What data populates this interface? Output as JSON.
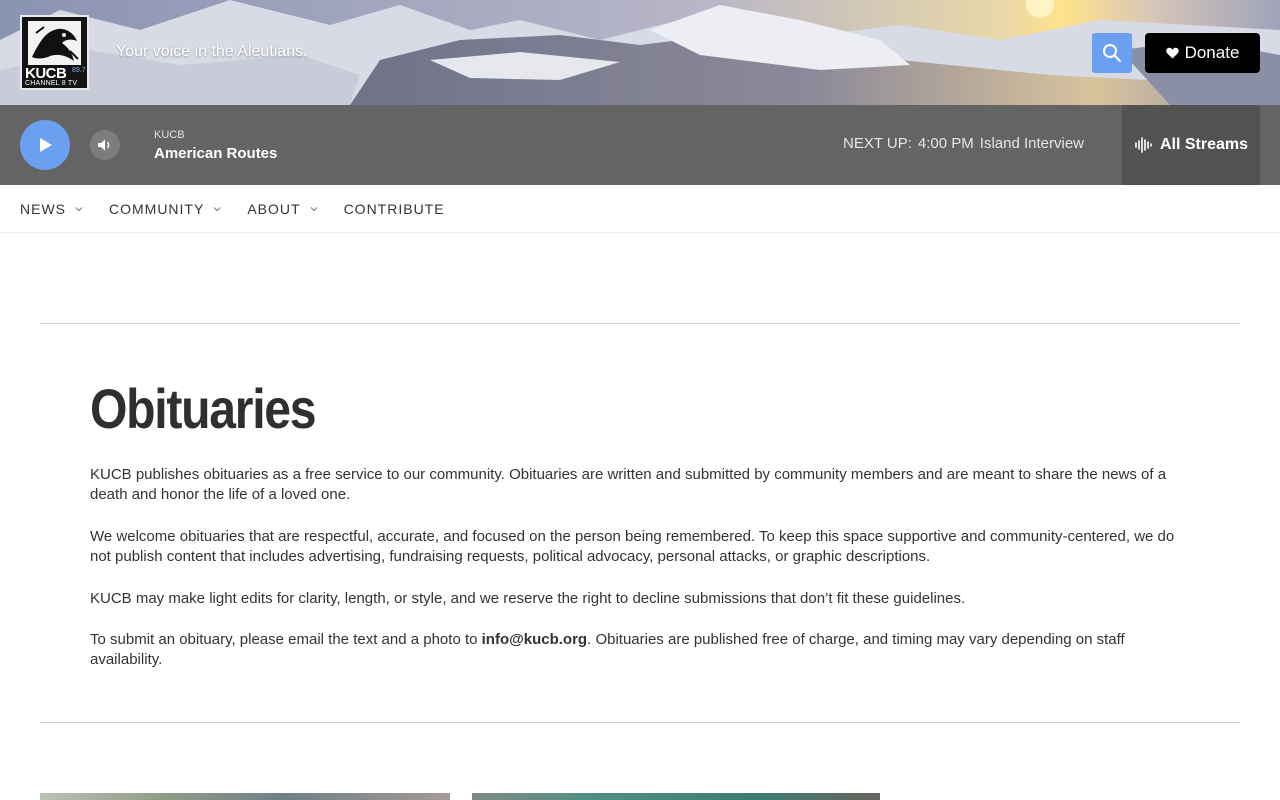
{
  "header": {
    "logo": {
      "call_letters": "KUCB",
      "frequency": "89.7",
      "channel": "CHANNEL 8 TV"
    },
    "tagline": "Your voice in the Aleutians.",
    "search_icon": "search-icon",
    "donate_label": "Donate",
    "donate_icon": "heart-icon"
  },
  "player": {
    "station": "KUCB",
    "program": "American Routes",
    "next_up_label": "NEXT UP:",
    "next_up_time": "4:00 PM",
    "next_up_program": "Island Interview",
    "streams_label": "All Streams",
    "play_icon": "play-icon",
    "volume_icon": "volume-icon",
    "streams_icon": "waveform-icon"
  },
  "nav": {
    "items": [
      {
        "label": "NEWS",
        "has_menu": true
      },
      {
        "label": "COMMUNITY",
        "has_menu": true
      },
      {
        "label": "ABOUT",
        "has_menu": true
      },
      {
        "label": "CONTRIBUTE",
        "has_menu": false
      }
    ]
  },
  "main": {
    "title": "Obituaries",
    "paragraphs": [
      "KUCB publishes obituaries as a free service to our community. Obituaries are written and submitted by community members and are meant to share the news of a death and honor the life of a loved one.",
      "We welcome obituaries that are respectful, accurate, and focused on the person being remembered. To keep this space supportive and community-centered, we do not publish content that includes advertising, fundraising requests, political advocacy, personal attacks, or graphic descriptions.",
      "KUCB may make light edits for clarity, length, or style, and we reserve the right to decline submissions that don’t fit these guidelines."
    ],
    "submit": {
      "before": "To submit an obituary, please email the text and a photo to ",
      "email": "info@kucb.org",
      "after": ". Obituaries are published free of charge, and timing may vary depending on staff availability."
    }
  },
  "colors": {
    "accent": "#6b9ff0",
    "player_bg": "#646464",
    "streams_bg": "#525252",
    "donate_bg": "#000000"
  }
}
